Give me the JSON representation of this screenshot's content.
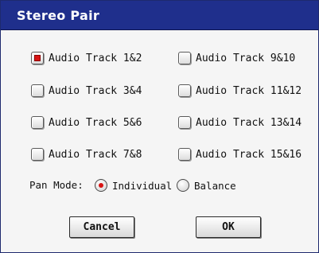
{
  "dialog": {
    "title": "Stereo Pair"
  },
  "tracks": [
    {
      "label": "Audio Track 1&2",
      "checked": true
    },
    {
      "label": "Audio Track 9&10",
      "checked": false
    },
    {
      "label": "Audio Track 3&4",
      "checked": false
    },
    {
      "label": "Audio Track 11&12",
      "checked": false
    },
    {
      "label": "Audio Track 5&6",
      "checked": false
    },
    {
      "label": "Audio Track 13&14",
      "checked": false
    },
    {
      "label": "Audio Track 7&8",
      "checked": false
    },
    {
      "label": "Audio Track 15&16",
      "checked": false
    }
  ],
  "pan_mode": {
    "label": "Pan Mode:",
    "options": [
      {
        "label": "Individual",
        "selected": true
      },
      {
        "label": "Balance",
        "selected": false
      }
    ]
  },
  "buttons": {
    "cancel": "Cancel",
    "ok": "OK"
  },
  "colors": {
    "title_bar": "#1f2f8c",
    "check_mark": "#d81414"
  }
}
